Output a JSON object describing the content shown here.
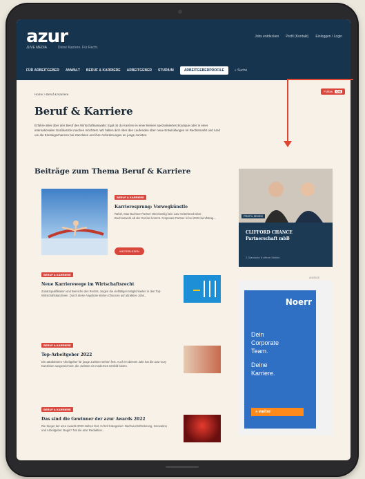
{
  "header": {
    "logo": "azur",
    "logo_sub": "JUVE MEDIA",
    "tagline": "Deine Karriere. Für Recht.",
    "top_links": [
      "Jobs entdecken",
      "Profil (Kontakt)",
      "Einloggen / Login"
    ],
    "nav": [
      "FÜR ARBEITGEBER",
      "ANWALT",
      "BERUF & KARRIERE",
      "ARBEITGEBER",
      "STUDIUM"
    ],
    "cta": "ARBEITGEBERPROFILE",
    "search": "Suche"
  },
  "pill": {
    "label": "Follow",
    "key": "ON"
  },
  "breadcrumb": "Home > Beruf & Karriere",
  "page_title": "Beruf & Karriere",
  "intro": "Erfahre alles über den Beruf des Wirtschaftsanwalts: Egal ob du Karriere in einer kleinen spezialisierten Boutique oder in einer internationalen Großkanzlei machen möchtest. Wir halten dich über den Laufenden über neue Entwicklungen im Rechtsmarkt und rund um die Einstiegschancen bei Kanzleien und ihre Anforderungen an junge Juristen.",
  "section_title": "Beiträge zum Thema Beruf & Karriere",
  "featured": {
    "badge": "BERUF & KARRIERE",
    "title": "Karrieresprung: Vorwegkünstle",
    "desc": "Rahel, Max Buchner Partner Gleichzeitig kein Law Heiterbrück über. Buchnetwork ab der Out-bei kommt. Corporate Partner in bei 2023 berufstrag...",
    "button": "WEITERLESEN"
  },
  "articles": [
    {
      "badge": "BERUF & KARRIERE",
      "title": "Neue Karrierewege im Wirtschaftsrecht",
      "desc": "Zusatzqualifikation und Bereiche des Rechts, zeigen die vielfältigen Möglichkeiten in den Top-Wirtschaftskanzleien. Durch diese Angebote stehen Chancen auf attraktive Jobs..."
    },
    {
      "badge": "BERUF & KARRIERE",
      "title": "Top-Arbeitgeber 2022",
      "desc": "Die attraktivsten Arbeitgeber für junge Juristen stehen fest. Auch im diesem Jahr hat die azur-Jury Kanzleien ausgezeichnet, die Juristen ein modernes Umfeld bieten."
    },
    {
      "badge": "BERUF & KARRIERE",
      "title": "Das sind die Gewinner der azur Awards 2022",
      "desc": "Die Sieger der azur Awards 2022 stehen fest. In fünf Kategorien: Nachwuchsförderung, Innovation und Arbeitgeber. Begin? hat die azur Redaktion..."
    }
  ],
  "ad1": {
    "tag": "PROFIL SEHEN",
    "name_line1": "CLIFFORD CHANCE",
    "name_line2": "Partnerschaft mbB",
    "footer": "2 Standorte   8 offene Stellen"
  },
  "ad2": {
    "label": "ANZEIGE",
    "brand": "Noerr",
    "line1": "Dein",
    "line2": "Corporate",
    "line3": "Team.",
    "line4": "Deine",
    "line5": "Karriere.",
    "button": "» weiter"
  },
  "colors": {
    "navy": "#17344f",
    "accent": "#d9463c",
    "cream": "#f7f1e8",
    "ad_blue": "#2f6fc4",
    "ad_orange": "#ff8a1c"
  }
}
